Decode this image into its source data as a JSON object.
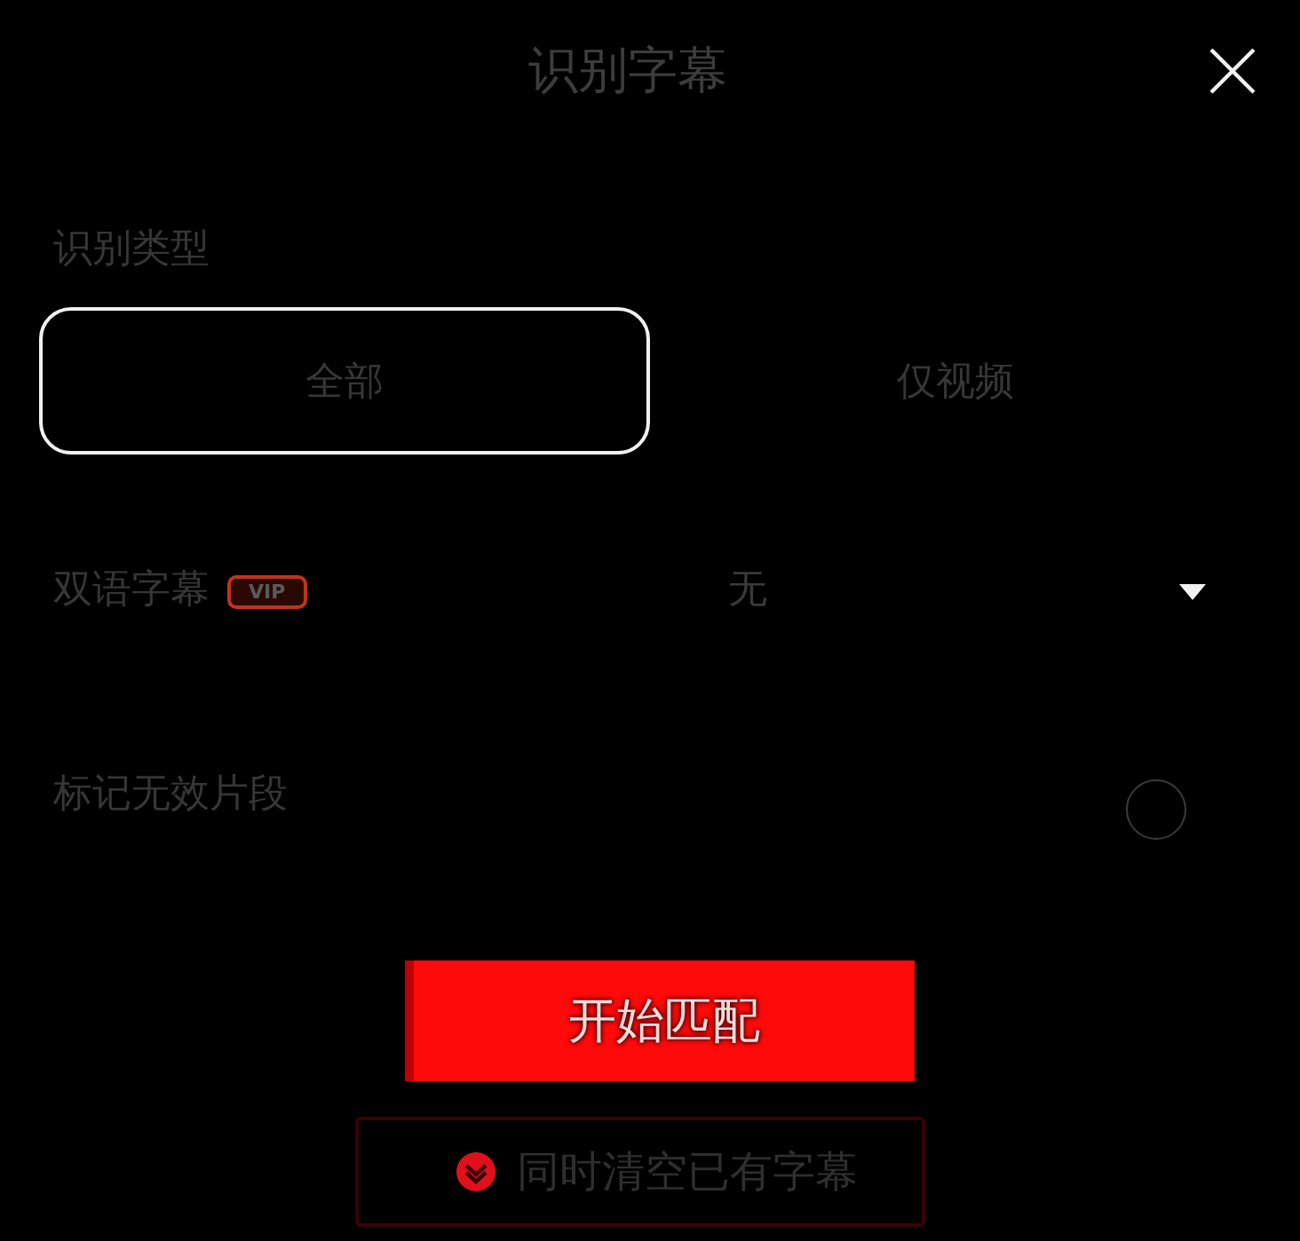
{
  "title": "识别字幕",
  "recognition_type": {
    "label": "识别类型",
    "options": [
      {
        "label": "全部",
        "selected": true
      },
      {
        "label": "仅视频",
        "selected": false
      }
    ]
  },
  "settings": [
    {
      "kind": "dropdown",
      "label": "双语字幕",
      "badge": "VIP",
      "value": "无"
    },
    {
      "kind": "toggle",
      "label": "标记无效片段",
      "on": false
    }
  ],
  "start_button": "开始匹配",
  "clear_option": {
    "label": "同时清空已有字幕",
    "checked": true
  }
}
